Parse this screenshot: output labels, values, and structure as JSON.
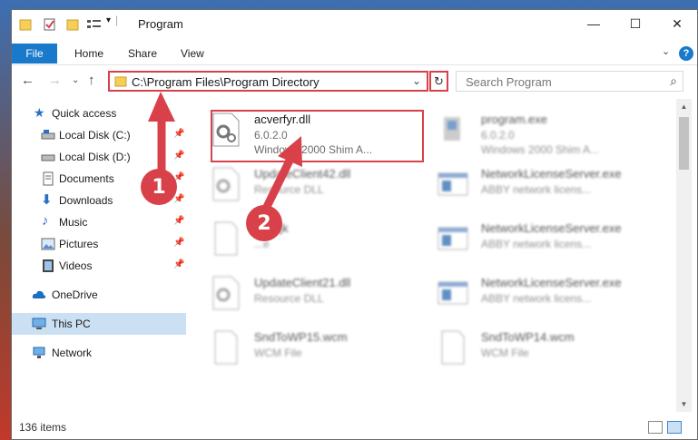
{
  "window": {
    "title": "Program",
    "controls": {
      "minimize": "—",
      "maximize": "☐",
      "close": "✕"
    }
  },
  "ribbon": {
    "tabs": [
      "File",
      "Home",
      "Share",
      "View"
    ],
    "help": "?"
  },
  "address": {
    "path": "C:\\Program Files\\Program Directory",
    "search_placeholder": "Search Program"
  },
  "sidebar": {
    "items": [
      {
        "label": "Quick access",
        "icon": "star-icon",
        "pinned": false
      },
      {
        "label": "Local Disk (C:)",
        "icon": "drive-icon",
        "pinned": true
      },
      {
        "label": "Local Disk (D:)",
        "icon": "drive-icon",
        "pinned": true
      },
      {
        "label": "Documents",
        "icon": "documents-icon",
        "pinned": true
      },
      {
        "label": "Downloads",
        "icon": "download-icon",
        "pinned": true
      },
      {
        "label": "Music",
        "icon": "music-icon",
        "pinned": true
      },
      {
        "label": "Pictures",
        "icon": "pictures-icon",
        "pinned": true
      },
      {
        "label": "Videos",
        "icon": "videos-icon",
        "pinned": true
      },
      {
        "label": "OneDrive",
        "icon": "cloud-icon",
        "pinned": false
      },
      {
        "label": "This PC",
        "icon": "computer-icon",
        "pinned": false,
        "selected": true
      },
      {
        "label": "Network",
        "icon": "network-icon",
        "pinned": false
      }
    ]
  },
  "files": [
    {
      "name": "acverfyr.dll",
      "line2": "6.0.2.0",
      "line3": "Windows 2000 Shim A...",
      "icon": "dll-icon",
      "highlighted": true
    },
    {
      "name": "program.exe",
      "line2": "6.0.2.0",
      "line3": "Windows 2000 Shim A...",
      "icon": "exe-icon"
    },
    {
      "name": "UpdateClient42.dll",
      "line2": "Resource DLL",
      "line3": "",
      "icon": "dll-icon"
    },
    {
      "name": "NetworkLicenseServer.exe",
      "line2": "ABBY network licens...",
      "line3": "",
      "icon": "app-window-icon"
    },
    {
      "name": "...n.cjk",
      "line2": "...e",
      "line3": "",
      "icon": "blank-file-icon"
    },
    {
      "name": "NetworkLicenseServer.exe",
      "line2": "ABBY network licens...",
      "line3": "",
      "icon": "app-window-icon"
    },
    {
      "name": "UpdateClient21.dll",
      "line2": "Resource DLL",
      "line3": "",
      "icon": "dll-icon"
    },
    {
      "name": "NetworkLicenseServer.exe",
      "line2": "ABBY network licens...",
      "line3": "",
      "icon": "app-window-icon"
    },
    {
      "name": "SndToWP15.wcm",
      "line2": "WCM File",
      "line3": "",
      "icon": "blank-file-icon"
    },
    {
      "name": "SndToWP14.wcm",
      "line2": "WCM File",
      "line3": "",
      "icon": "blank-file-icon"
    }
  ],
  "status": {
    "count": "136 items"
  },
  "badges": [
    "1",
    "2"
  ],
  "colors": {
    "accent": "#1979ca",
    "highlight": "#d9414a",
    "selected": "#cce0f4"
  }
}
